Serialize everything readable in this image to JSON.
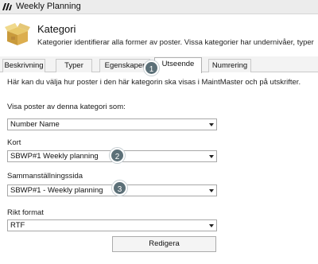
{
  "window": {
    "title": "Weekly Planning",
    "app_icon": "maintmaster-logo-icon"
  },
  "header": {
    "icon": "box-icon",
    "title": "Kategori",
    "description": "Kategorier identifierar alla former av poster. Vissa kategorier har undernivåer, typer"
  },
  "tabs": [
    {
      "label": "Beskrivning",
      "active": false
    },
    {
      "label": "Typer",
      "active": false
    },
    {
      "label": "Egenskaper",
      "active": false
    },
    {
      "label": "Utseende",
      "active": true
    },
    {
      "label": "Numrering",
      "active": false
    }
  ],
  "intro": "Här kan du välja hur poster i den här kategorin ska visas i MaintMaster och på utskrifter.",
  "fields": {
    "display_as": {
      "label": "Visa poster av denna kategori som:",
      "value": "Number Name"
    },
    "card": {
      "label": "Kort",
      "value": "SBWP#1 Weekly planning"
    },
    "summary_page": {
      "label": "Sammanställningssida",
      "value": "SBWP#1 - Weekly planning"
    },
    "rich_format": {
      "label": "Rikt format",
      "value": "RTF"
    }
  },
  "edit_button": "Redigera",
  "badges": [
    "1",
    "2",
    "3"
  ],
  "colors": {
    "badge": "#5c7078",
    "titlebar": "#ececec"
  }
}
